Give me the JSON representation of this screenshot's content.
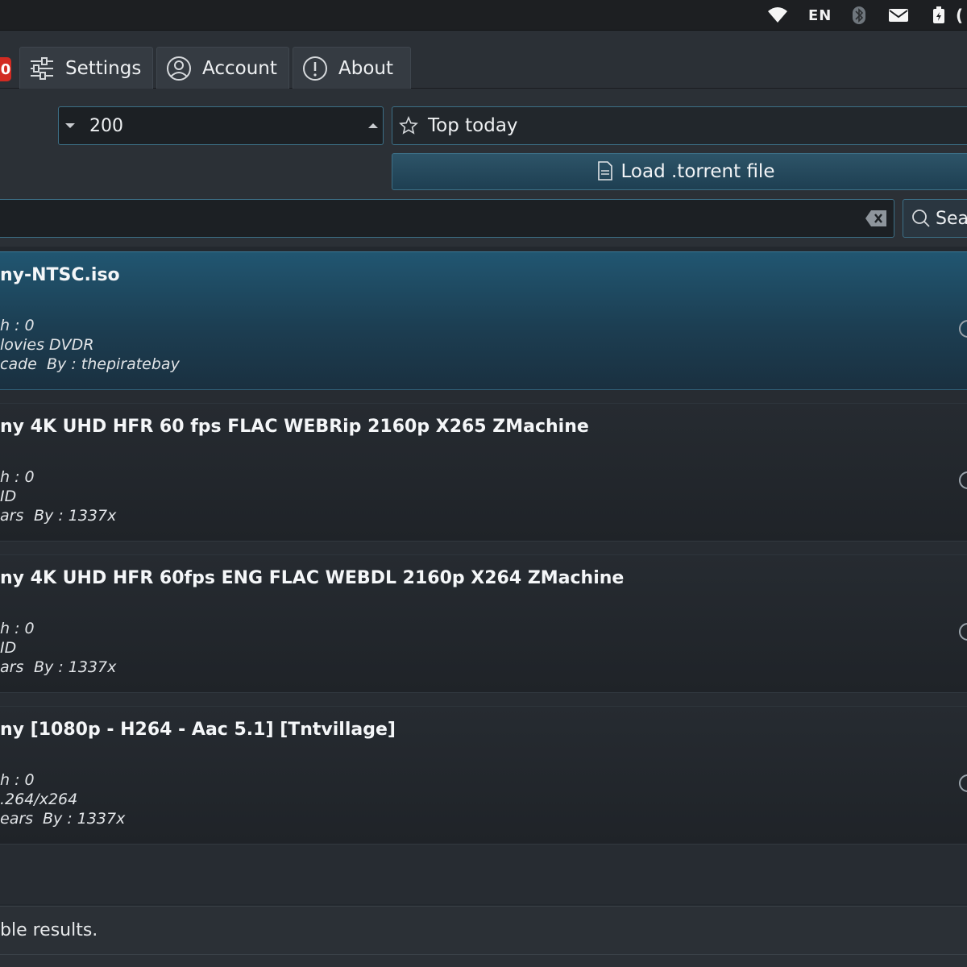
{
  "tray": {
    "language": "EN"
  },
  "tabs": {
    "badge_count": "0",
    "settings_label": "Settings",
    "account_label": "Account",
    "about_label": "About"
  },
  "controls": {
    "count_value": "200",
    "sort_value": "Top today",
    "load_torrent_label": "Load .torrent file",
    "search_button_label": "Sea"
  },
  "results": [
    {
      "title": "ny-NTSC.iso",
      "line1": "h : 0",
      "line2": "lovies DVDR",
      "age": "cade",
      "by": "By : thepiratebay"
    },
    {
      "title": "ny 4K UHD HFR 60 fps FLAC WEBRip 2160p X265 ZMachine",
      "line1": "h : 0",
      "line2": "ID",
      "age": "ars",
      "by": "By : 1337x"
    },
    {
      "title": "ny 4K UHD HFR 60fps ENG FLAC WEBDL 2160p X264 ZMachine",
      "line1": "h : 0",
      "line2": "ID",
      "age": "ars",
      "by": "By : 1337x"
    },
    {
      "title": "ny [1080p - H264 - Aac 5.1] [Tntvillage]",
      "line1": "h : 0",
      "line2": ".264/x264",
      "age": "ears",
      "by": "By : 1337x"
    }
  ],
  "status_text": "ble results."
}
